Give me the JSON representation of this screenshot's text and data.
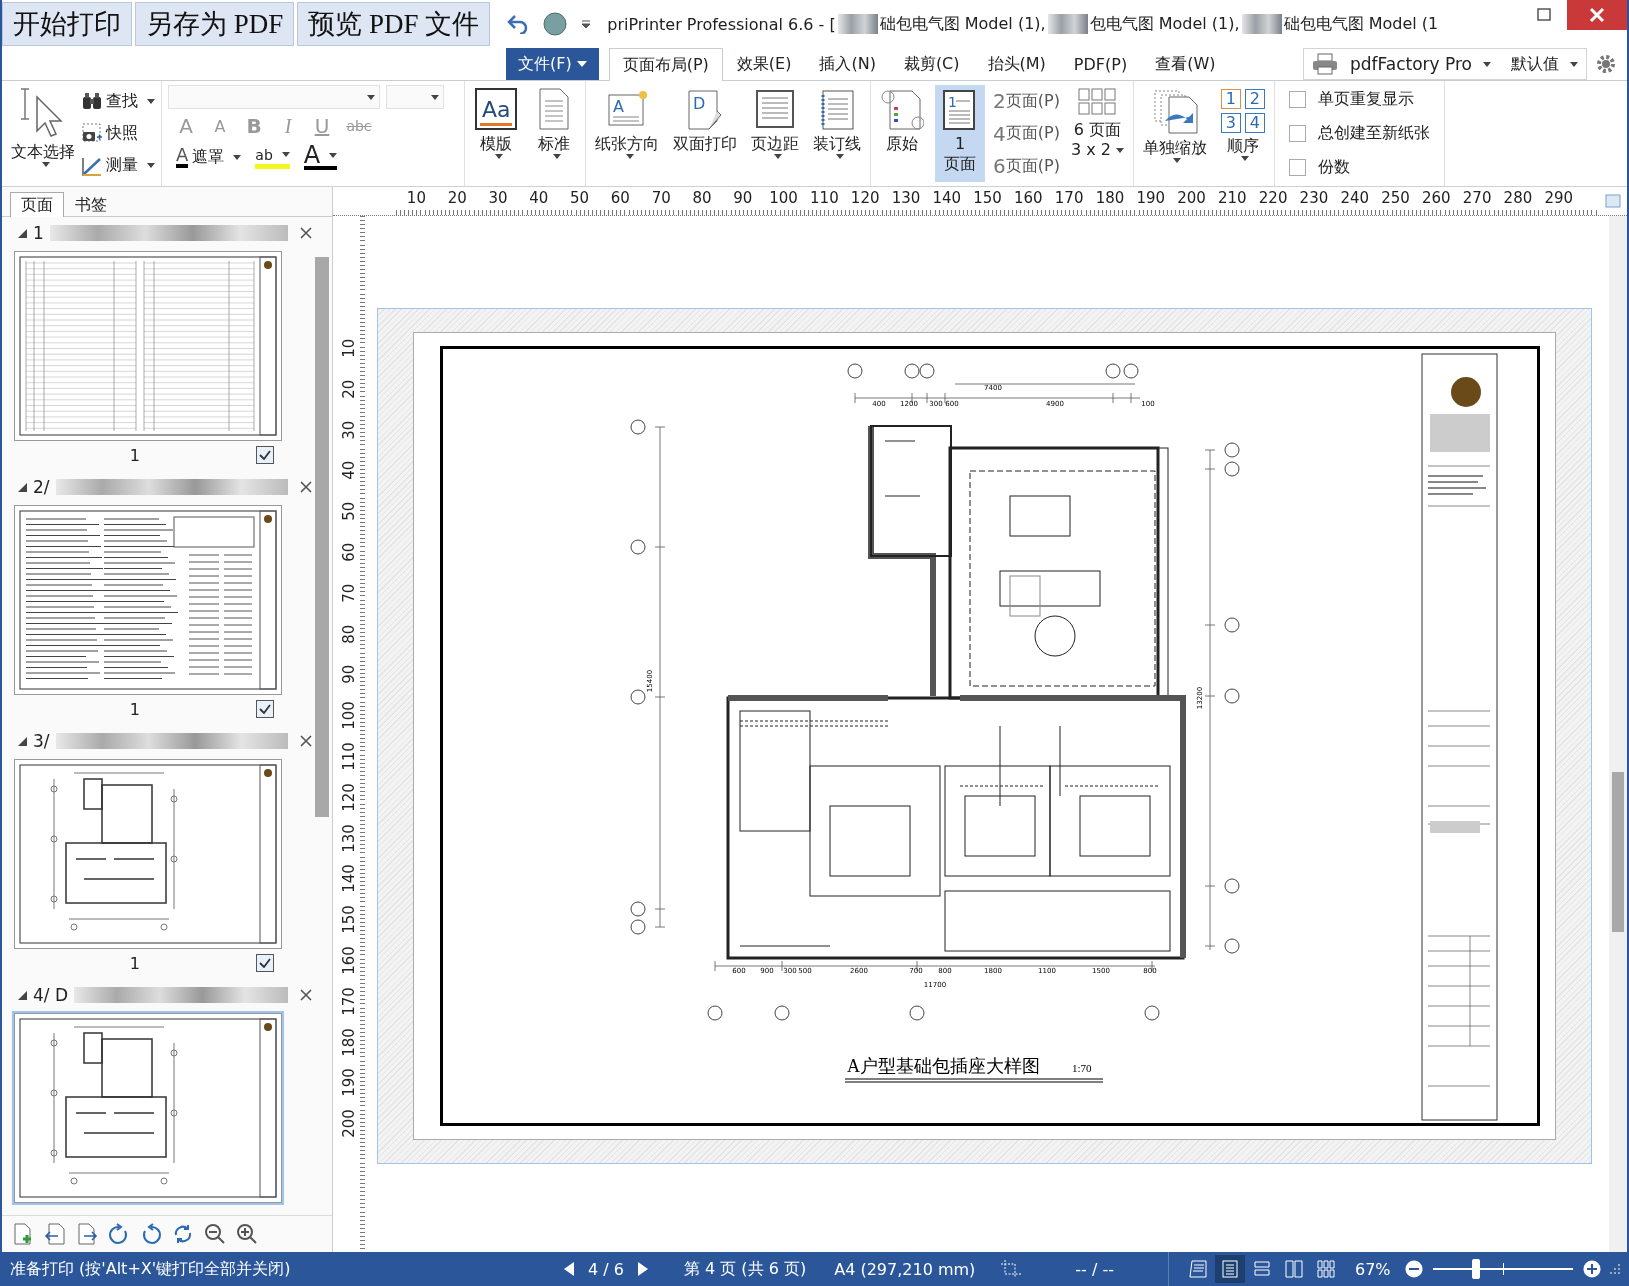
{
  "quick_buttons": [
    "开始打印",
    "另存为 PDF",
    "预览 PDF 文件"
  ],
  "window": {
    "title_parts": [
      "priPrinter Professional 6.6 - [",
      "础包电气图 Model (1),",
      "包电气图 Model (1),",
      "础包电气图 Model (1"
    ]
  },
  "file_button": "文件(F)",
  "tabs": [
    {
      "label": "页面布局(P)",
      "selected": true
    },
    {
      "label": "效果(E)",
      "selected": false
    },
    {
      "label": "插入(N)",
      "selected": false
    },
    {
      "label": "裁剪(C)",
      "selected": false
    },
    {
      "label": "抬头(M)",
      "selected": false
    },
    {
      "label": "PDF(P)",
      "selected": false
    },
    {
      "label": "查看(W)",
      "selected": false
    }
  ],
  "printer": {
    "name": "pdfFactory Pro",
    "preset": "默认值"
  },
  "ribbon": {
    "text_select": "文本选择",
    "small_tools": [
      {
        "kind": "find",
        "label": "查找",
        "dropdown": true
      },
      {
        "kind": "snapshot",
        "label": "快照",
        "dropdown": false
      },
      {
        "kind": "measure",
        "label": "测量",
        "dropdown": true
      }
    ],
    "format_buttons": [
      {
        "kind": "grow",
        "glyph": "A"
      },
      {
        "kind": "shrink",
        "glyph": "A"
      },
      {
        "kind": "bold",
        "glyph": "B"
      },
      {
        "kind": "italic",
        "glyph": "I"
      },
      {
        "kind": "underline",
        "glyph": "U"
      },
      {
        "kind": "strike",
        "glyph": "abc"
      }
    ],
    "mask": {
      "glyph": "A",
      "label": "遮罩"
    },
    "highlight": {
      "glyph": "ab"
    },
    "font_color": {
      "glyph": "A"
    },
    "big_buttons": [
      {
        "kind": "template",
        "glyph": "Aa",
        "label": "模版",
        "dropdown": true,
        "selected": false
      },
      {
        "kind": "standard",
        "label": "标准",
        "dropdown": true,
        "selected": false
      },
      {
        "kind": "orientation",
        "glyph": "A",
        "label": "纸张方向",
        "dropdown": true,
        "selected": false
      },
      {
        "kind": "duplex",
        "glyph": "D",
        "label": "双面打印",
        "dropdown": false,
        "selected": false
      },
      {
        "kind": "margins",
        "label": "页边距",
        "dropdown": true,
        "selected": false
      },
      {
        "kind": "binding",
        "label": "装订线",
        "dropdown": true,
        "selected": false
      },
      {
        "kind": "original",
        "label": "原始",
        "dropdown": false,
        "selected": false
      },
      {
        "kind": "onepage",
        "glyph": "1",
        "label": "1\n页面",
        "dropdown": false,
        "selected": true
      }
    ],
    "page_options": [
      {
        "number": "2",
        "label": "页面(P)"
      },
      {
        "number": "4",
        "label": "页面(P)"
      },
      {
        "number": "6",
        "label": "页面(P)"
      }
    ],
    "grid_button": {
      "label": "6 页面",
      "sub": "3 x 2"
    },
    "scale_button": "单独缩放",
    "order_button": {
      "label": "顺序",
      "glyphs": [
        "1",
        "2",
        "3",
        "4"
      ]
    },
    "checkboxes": [
      {
        "label": "单页重复显示",
        "checked": false
      },
      {
        "label": "总创建至新纸张",
        "checked": false
      },
      {
        "label": "份数",
        "checked": false
      }
    ]
  },
  "sidebar": {
    "tabs": [
      {
        "label": "页面",
        "selected": true
      },
      {
        "label": "书签",
        "selected": false
      }
    ],
    "pages": [
      {
        "label": "1",
        "kind": "table",
        "number": "1",
        "checked": true,
        "selected": false
      },
      {
        "label": "2/",
        "kind": "text",
        "number": "1",
        "checked": true,
        "selected": false
      },
      {
        "label": "3/",
        "kind": "plan",
        "number": "1",
        "checked": true,
        "selected": false
      },
      {
        "label": "4/ D",
        "kind": "plan",
        "selected": true
      }
    ]
  },
  "ruler": {
    "h": [
      "10",
      "20",
      "30",
      "40",
      "50",
      "60",
      "70",
      "80",
      "90",
      "100",
      "110",
      "120",
      "130",
      "140",
      "150",
      "160",
      "170",
      "180",
      "190",
      "200",
      "210",
      "220",
      "230",
      "240",
      "250",
      "260",
      "270",
      "280",
      "290"
    ],
    "v": [
      "10",
      "20",
      "30",
      "40",
      "50",
      "60",
      "70",
      "80",
      "90",
      "100",
      "110",
      "120",
      "130",
      "140",
      "150",
      "160",
      "170",
      "180",
      "190",
      "200"
    ]
  },
  "drawing": {
    "title": "A户型基础包插座大样图",
    "scale": "1:70",
    "top_dims": [
      "400",
      "1200",
      "300",
      "600",
      "4900",
      "100"
    ],
    "top_total": "7400",
    "bottom_dims": [
      "600",
      "900",
      "300",
      "500",
      "2600",
      "700",
      "800",
      "1800",
      "1100",
      "1500",
      "800"
    ],
    "bottom_total": "11700",
    "left_total": "15400",
    "right_total": "13200"
  },
  "status": {
    "message": "准备打印 (按'Alt+X'键打印全部并关闭)",
    "pager": "4 / 6",
    "page_info": "第 4 页 (共 6 页)",
    "paper": "A4 (297,210 mm)",
    "coords": "-- / --",
    "views": [
      {
        "kind": "doc",
        "selected": false
      },
      {
        "kind": "single",
        "selected": true
      },
      {
        "kind": "rows",
        "selected": false
      },
      {
        "kind": "columns",
        "selected": false
      },
      {
        "kind": "grid",
        "selected": false
      }
    ],
    "zoom": "67%",
    "zoom_slider": {
      "level": 0.31
    }
  }
}
